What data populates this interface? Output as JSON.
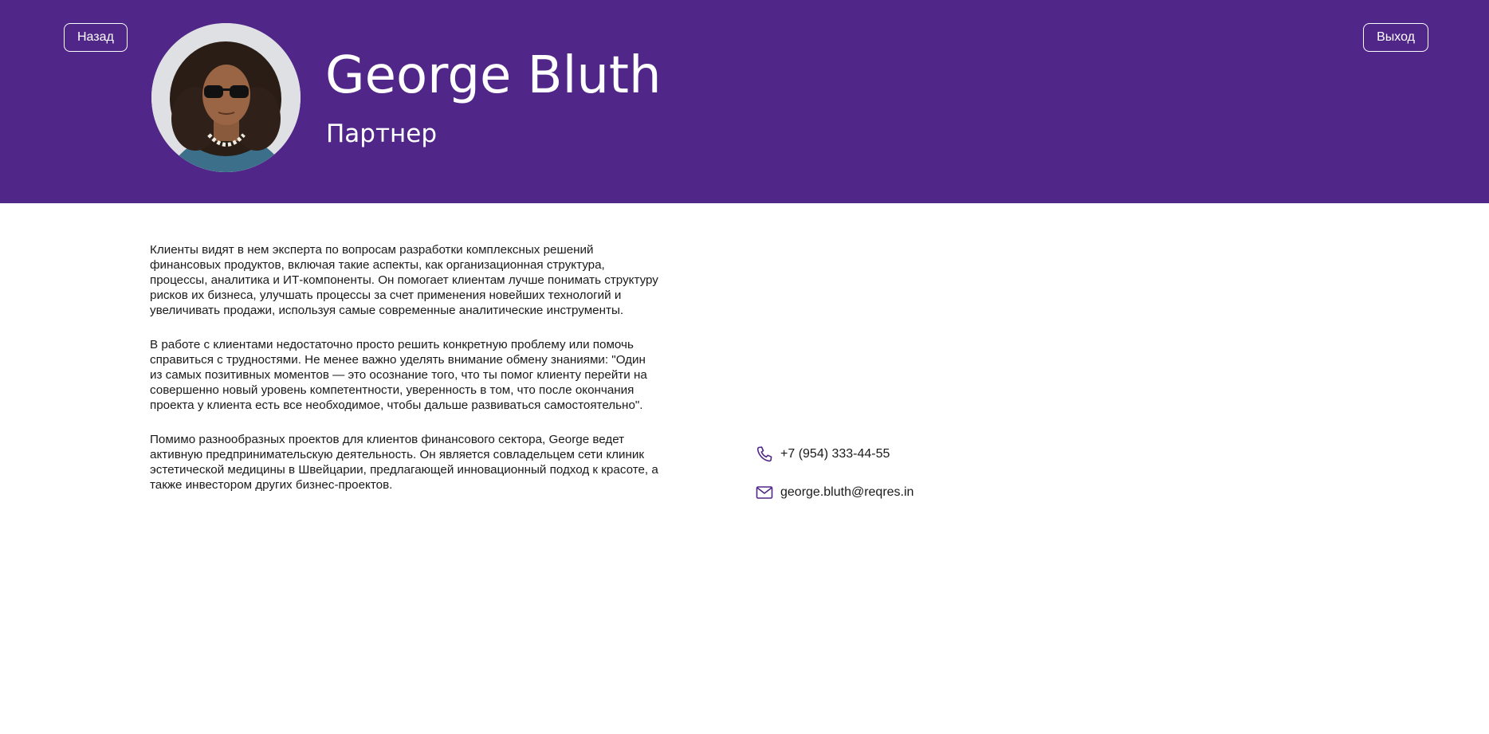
{
  "header": {
    "back_label": "Назад",
    "logout_label": "Выход",
    "name": "George Bluth",
    "role": "Партнер"
  },
  "bio": {
    "paragraphs": [
      "Клиенты видят в нем эксперта по вопросам разработки комплексных решений финансовых продуктов, включая такие аспекты, как организационная структура, процессы, аналитика и ИТ-компоненты. Он помогает клиентам лучше понимать структуру рисков их бизнеса, улучшать процессы за счет применения новейших технологий и увеличивать продажи, используя самые современные аналитические инструменты.",
      "В работе с клиентами недостаточно просто решить конкретную проблему или помочь справиться с трудностями. Не менее важно уделять внимание обмену знаниями: \"Один из самых позитивных моментов — это осознание того, что ты помог клиенту перейти на совершенно новый уровень компетентности, уверенность в том, что после окончания проекта у клиента есть все необходимое, чтобы дальше развиваться самостоятельно\".",
      "Помимо разнообразных проектов для клиентов финансового сектора, George ведет активную предпринимательскую деятельность. Он является совладельцем сети клиник эстетической медицины в Швейцарии, предлагающей инновационный подход к красоте, а также инвестором других бизнес-проектов."
    ]
  },
  "contacts": {
    "phone": "+7 (954) 333-44-55",
    "email": "george.bluth@reqres.in",
    "phone_icon": "phone-icon",
    "email_icon": "mail-icon"
  },
  "colors": {
    "header_bg": "#512689",
    "icon_color": "#512689",
    "text": "#1a1a1a"
  }
}
